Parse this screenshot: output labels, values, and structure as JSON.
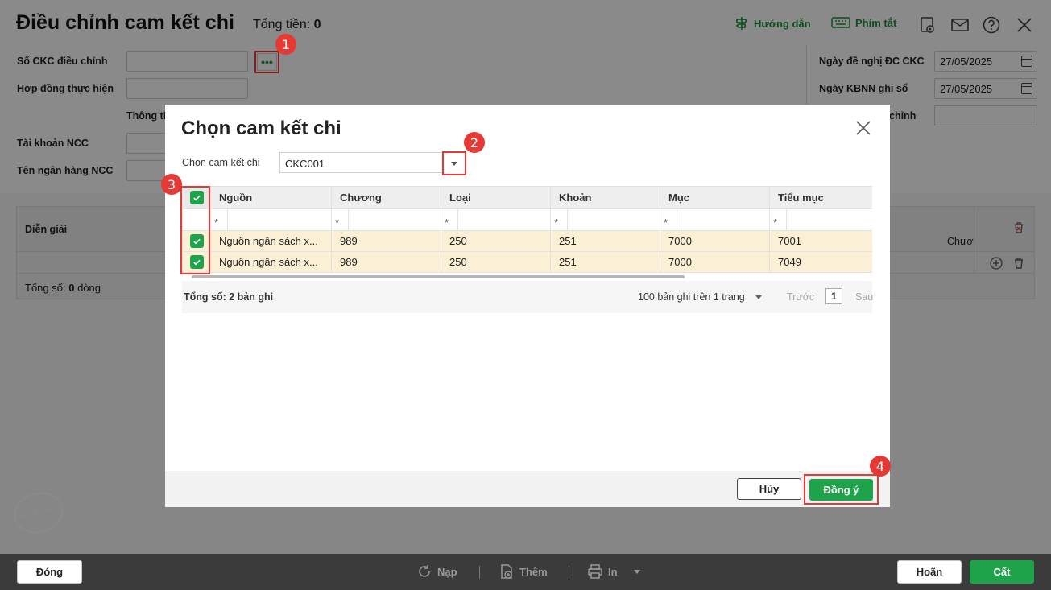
{
  "form": {
    "title": "Điều chỉnh cam kết chi",
    "total_label": "Tổng tiền:",
    "total_value": "0",
    "guide_label": "Hướng dẫn",
    "shortcut_label": "Phím tắt",
    "fields": {
      "ckc_number": "Số CKC điều chỉnh",
      "contract": "Hợp đồng thực hiện",
      "info_partial": "Thông ti",
      "ncc_account": "Tài khoản NCC",
      "ncc_bank": "Tên ngân hàng NCC",
      "request_date_label": "Ngày đề nghị ĐC CKC",
      "request_date_value": "27/05/2025",
      "kbnn_date_label": "Ngày KBNN ghi sổ",
      "kbnn_date_value": "27/05/2025",
      "adjust_partial": "chỉnh"
    },
    "grid": {
      "col_desc": "Diễn giải",
      "col_chapter_partial": "Chươ",
      "total_rows_prefix": "Tổng số:",
      "total_rows_value": "0",
      "total_rows_suffix": "dòng"
    },
    "stamp_text": "DỮ LIỆU MẪU"
  },
  "footer": {
    "close": "Đóng",
    "reload": "Nạp",
    "add": "Thêm",
    "print": "In",
    "defer": "Hoãn",
    "save": "Cất"
  },
  "dialog": {
    "title": "Chọn cam kết chi",
    "select_label": "Chọn cam kết chi",
    "select_value": "CKC001",
    "columns": [
      "Nguồn",
      "Chương",
      "Loại",
      "Khoản",
      "Mục",
      "Tiểu mục"
    ],
    "filter_symbol": "*",
    "rows": [
      {
        "checked": true,
        "cells": [
          "Nguồn ngân sách x...",
          "989",
          "250",
          "251",
          "7000",
          "7001"
        ]
      },
      {
        "checked": true,
        "cells": [
          "Nguồn ngân sách x...",
          "989",
          "250",
          "251",
          "7000",
          "7049"
        ]
      }
    ],
    "pager": {
      "total": "Tổng số: 2 bản ghi",
      "per_page": "100 bản ghi trên 1 trang",
      "prev": "Trước",
      "page": "1",
      "next": "Sau"
    },
    "cancel": "Hủy",
    "ok": "Đồng ý"
  },
  "badges": [
    "1",
    "2",
    "3",
    "4"
  ],
  "colors": {
    "accent_green": "#1ea34b",
    "highlight_red": "#e53935",
    "selected_row": "#fbf0d5"
  }
}
